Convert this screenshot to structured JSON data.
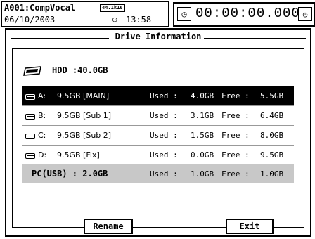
{
  "status": {
    "song_name": "A001:CompVocal",
    "sample_rate": "44.1k16",
    "date": "06/10/2003",
    "time": "13:58",
    "counter": "00:00:00.000"
  },
  "dialog": {
    "title": "Drive Information",
    "hdd_label": "HDD :40.0GB",
    "drives": [
      {
        "letter": "A:",
        "capacity": "9.5GB [MAIN]",
        "used_label": "Used :",
        "used": "4.0GB",
        "free_label": "Free :",
        "free": "5.5GB",
        "selected": true
      },
      {
        "letter": "B:",
        "capacity": "9.5GB [Sub 1]",
        "used_label": "Used :",
        "used": "3.1GB",
        "free_label": "Free :",
        "free": "6.4GB",
        "selected": false
      },
      {
        "letter": "C:",
        "capacity": "9.5GB [Sub 2]",
        "used_label": "Used :",
        "used": "1.5GB",
        "free_label": "Free :",
        "free": "8.0GB",
        "selected": false
      },
      {
        "letter": "D:",
        "capacity": "9.5GB [Fix]",
        "used_label": "Used :",
        "used": "0.0GB",
        "free_label": "Free :",
        "free": "9.5GB",
        "selected": false
      }
    ],
    "pc": {
      "label": "PC(USB) : 2.0GB",
      "used_label": "Used :",
      "used": "1.0GB",
      "free_label": "Free :",
      "free": "1.0GB"
    },
    "rename_label": "Rename",
    "exit_label": "Exit"
  },
  "icons": {
    "clock": "clock-icon",
    "counter_clock": "clock-icon",
    "counter_end": "end-icon",
    "hdd": "hdd-icon",
    "drive": "drive-icon"
  }
}
